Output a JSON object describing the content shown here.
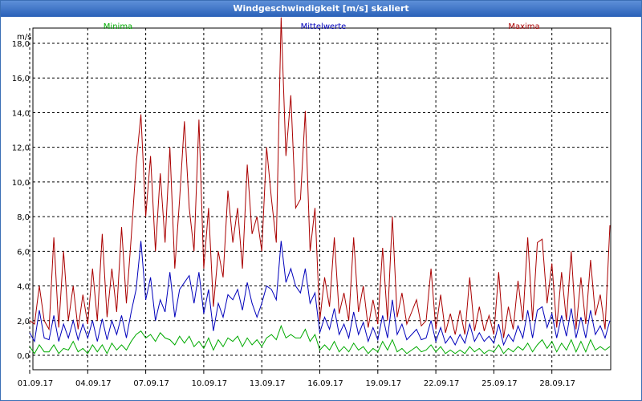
{
  "window_title": "Windgeschwindigkeit [m/s] skaliert",
  "colors": {
    "minima": "#00aa00",
    "mittel": "#0000bb",
    "maxima": "#aa0000",
    "title_bar": "#2a61b8"
  },
  "chart_data": {
    "type": "line",
    "title": "Windgeschwindigkeit [m/s] skaliert",
    "ylabel": "m/s",
    "xlabel": "",
    "ylim": [
      0,
      20
    ],
    "xlim": [
      0,
      30
    ],
    "grid": true,
    "legend_position": "top",
    "yticks": [
      0,
      2,
      4,
      6,
      8,
      10,
      12,
      14,
      16,
      18
    ],
    "ytick_labels": [
      "0,0",
      "2,0",
      "4,0",
      "6,0",
      "8,0",
      "10,0",
      "12,0",
      "14,0",
      "16,0",
      "18,0"
    ],
    "xticks": [
      0,
      3,
      6,
      9,
      12,
      15,
      18,
      21,
      24,
      27
    ],
    "xtick_labels": [
      "01.09.17",
      "04.09.17",
      "07.09.17",
      "10.09.17",
      "13.09.17",
      "16.09.17",
      "19.09.17",
      "22.09.17",
      "25.09.17",
      "28.09.17"
    ],
    "x": [
      0.0,
      0.25,
      0.5,
      0.75,
      1.0,
      1.25,
      1.5,
      1.75,
      2.0,
      2.25,
      2.5,
      2.75,
      3.0,
      3.25,
      3.5,
      3.75,
      4.0,
      4.25,
      4.5,
      4.75,
      5.0,
      5.25,
      5.5,
      5.75,
      6.0,
      6.25,
      6.5,
      6.75,
      7.0,
      7.25,
      7.5,
      7.75,
      8.0,
      8.25,
      8.5,
      8.75,
      9.0,
      9.25,
      9.5,
      9.75,
      10.0,
      10.25,
      10.5,
      10.75,
      11.0,
      11.25,
      11.5,
      11.75,
      12.0,
      12.25,
      12.5,
      12.75,
      13.0,
      13.25,
      13.5,
      13.75,
      14.0,
      14.25,
      14.5,
      14.75,
      15.0,
      15.25,
      15.5,
      15.75,
      16.0,
      16.25,
      16.5,
      16.75,
      17.0,
      17.25,
      17.5,
      17.75,
      18.0,
      18.25,
      18.5,
      18.75,
      19.0,
      19.25,
      19.5,
      19.75,
      20.0,
      20.25,
      20.5,
      20.75,
      21.0,
      21.25,
      21.5,
      21.75,
      22.0,
      22.25,
      22.5,
      22.75,
      23.0,
      23.25,
      23.5,
      23.75,
      24.0,
      24.25,
      24.5,
      24.75,
      25.0,
      25.25,
      25.5,
      25.75,
      26.0,
      26.25,
      26.5,
      26.75,
      27.0,
      27.25,
      27.5,
      27.75,
      28.0,
      28.25,
      28.5,
      28.75,
      29.0,
      29.25,
      29.5,
      29.75,
      30.0
    ],
    "series": [
      {
        "name": "Minima",
        "color": "#00aa00",
        "values": [
          0.5,
          0.1,
          0.6,
          0.2,
          0.2,
          0.6,
          0.1,
          0.4,
          0.3,
          0.8,
          0.2,
          0.4,
          0.1,
          0.6,
          0.2,
          0.6,
          0.1,
          0.7,
          0.3,
          0.6,
          0.3,
          0.8,
          1.2,
          1.4,
          1.0,
          1.2,
          0.8,
          1.3,
          1.0,
          0.9,
          0.6,
          1.1,
          0.7,
          1.1,
          0.5,
          0.8,
          0.4,
          1.0,
          0.3,
          0.9,
          0.5,
          1.0,
          0.8,
          1.1,
          0.5,
          1.0,
          0.6,
          0.9,
          0.5,
          1.0,
          1.2,
          0.9,
          1.7,
          1.0,
          1.2,
          1.0,
          1.0,
          1.5,
          0.8,
          1.2,
          0.3,
          0.6,
          0.3,
          0.8,
          0.2,
          0.5,
          0.2,
          0.7,
          0.3,
          0.5,
          0.1,
          0.4,
          0.2,
          0.8,
          0.3,
          0.9,
          0.2,
          0.4,
          0.1,
          0.3,
          0.5,
          0.2,
          0.3,
          0.6,
          0.2,
          0.5,
          0.1,
          0.3,
          0.1,
          0.3,
          0.1,
          0.5,
          0.2,
          0.4,
          0.1,
          0.3,
          0.2,
          0.6,
          0.1,
          0.4,
          0.2,
          0.5,
          0.3,
          0.7,
          0.2,
          0.6,
          0.9,
          0.4,
          0.8,
          0.2,
          0.7,
          0.3,
          0.9,
          0.2,
          0.8,
          0.2,
          0.9,
          0.3,
          0.5,
          0.3,
          0.5
        ]
      },
      {
        "name": "Mittelwerte",
        "color": "#0000bb",
        "values": [
          1.3,
          0.8,
          2.6,
          1.0,
          0.9,
          2.3,
          0.8,
          1.8,
          1.0,
          2.0,
          0.9,
          1.8,
          1.0,
          2.0,
          0.8,
          2.1,
          0.9,
          2.0,
          1.2,
          2.3,
          1.0,
          2.5,
          3.8,
          6.6,
          3.2,
          4.5,
          2.0,
          3.2,
          2.5,
          4.8,
          2.2,
          3.8,
          4.2,
          4.6,
          3.0,
          4.8,
          2.4,
          3.8,
          1.4,
          3.0,
          2.2,
          3.5,
          3.2,
          3.8,
          2.6,
          4.2,
          3.0,
          2.2,
          3.0,
          4.0,
          3.8,
          3.2,
          6.6,
          4.2,
          5.0,
          4.0,
          3.6,
          5.0,
          3.0,
          3.6,
          1.3,
          2.2,
          1.5,
          2.7,
          1.2,
          1.8,
          1.0,
          2.5,
          1.2,
          1.9,
          0.8,
          1.6,
          0.9,
          2.3,
          1.0,
          3.2,
          1.2,
          1.8,
          0.9,
          1.2,
          1.5,
          0.9,
          1.0,
          2.0,
          0.8,
          1.6,
          0.7,
          1.1,
          0.6,
          1.2,
          0.7,
          1.8,
          0.8,
          1.3,
          0.8,
          1.1,
          0.7,
          1.8,
          0.6,
          1.2,
          0.8,
          1.7,
          1.0,
          2.6,
          1.0,
          2.6,
          2.8,
          1.6,
          2.4,
          1.0,
          2.3,
          1.1,
          2.7,
          1.0,
          2.2,
          1.0,
          2.6,
          1.2,
          1.7,
          1.0,
          2.0
        ]
      },
      {
        "name": "Maxima",
        "color": "#aa0000",
        "values": [
          2.0,
          1.8,
          4.0,
          2.0,
          1.5,
          6.8,
          1.6,
          6.0,
          2.0,
          4.0,
          1.5,
          3.5,
          1.8,
          5.0,
          2.0,
          7.0,
          2.2,
          5.0,
          2.5,
          7.4,
          3.0,
          6.8,
          11.0,
          13.9,
          8.0,
          11.5,
          6.0,
          10.5,
          6.5,
          12.0,
          5.0,
          9.0,
          13.5,
          8.5,
          6.0,
          13.6,
          5.0,
          8.5,
          2.8,
          6.0,
          4.5,
          9.5,
          6.5,
          8.5,
          5.0,
          11.0,
          7.0,
          8.0,
          6.0,
          12.0,
          9.0,
          6.5,
          19.5,
          11.5,
          15.0,
          8.5,
          9.0,
          14.1,
          6.0,
          8.5,
          2.0,
          4.5,
          2.8,
          6.8,
          2.4,
          3.6,
          2.0,
          6.8,
          2.5,
          4.0,
          1.6,
          3.2,
          1.8,
          6.2,
          2.0,
          8.0,
          2.2,
          3.6,
          1.8,
          2.5,
          3.2,
          1.7,
          2.0,
          5.0,
          1.5,
          3.5,
          1.3,
          2.4,
          1.2,
          2.6,
          1.2,
          4.5,
          1.4,
          2.8,
          1.4,
          2.3,
          1.2,
          4.8,
          1.0,
          2.8,
          1.5,
          4.3,
          2.0,
          6.8,
          2.0,
          6.5,
          6.7,
          3.0,
          5.3,
          1.6,
          4.8,
          2.0,
          6.0,
          1.5,
          4.5,
          1.8,
          5.5,
          2.3,
          3.5,
          1.5,
          7.5
        ]
      }
    ]
  }
}
